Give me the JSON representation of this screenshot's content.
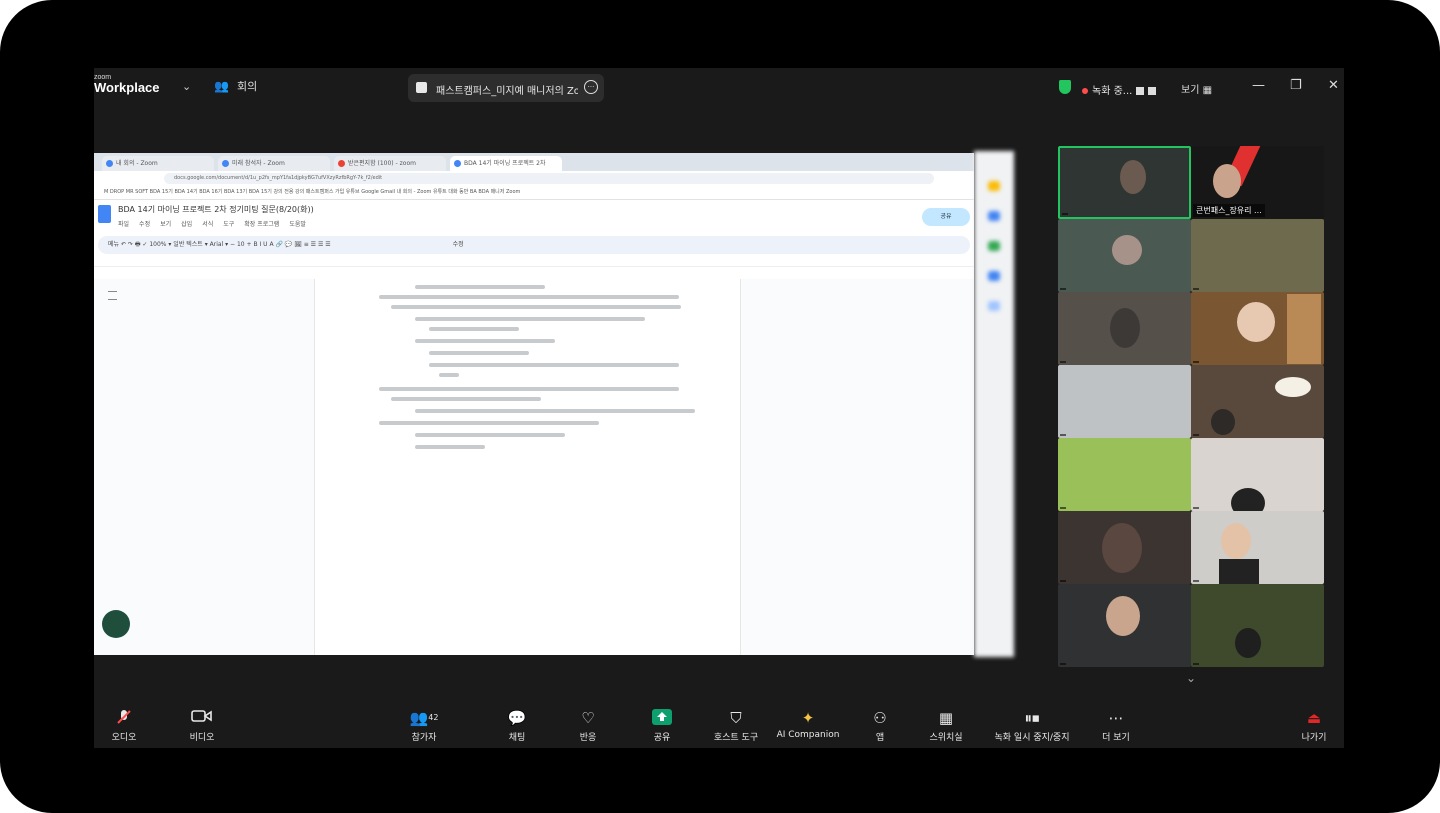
{
  "window": {
    "logo_top": "zoom",
    "logo_bottom": "Workplace",
    "meeting_label": "회의",
    "meeting_title": "패스트캠퍼스_미지예 매니저의 Zoom 회의",
    "recording_text": "녹화 중...",
    "view_label": "보기"
  },
  "shared_screen": {
    "browser_tabs": [
      {
        "label": "내 회의 - Zoom"
      },
      {
        "label": "미래 참석자 - Zoom"
      },
      {
        "label": "받은편지함 (100) - zoom"
      },
      {
        "label": "BDA 14기 마이닝 프로젝트 2차"
      }
    ],
    "address": "docs.google.com/document/d/1u_p2fs_mpY1fa1djpkyBG7ufVXzyRzfbRgY-7k_f2/edit",
    "bookmarks": "M DROP MR SOFT   BDA 15기   BDA 14기   BDA 16기   BDA 13기   BDA 15기   강의 전용   강의   패스트캠퍼스   가입   유튜브   Google   Gmail   내 회의 - Zoom   유튜트 대화 동반 BA   BDA 매니저   Zoom",
    "doc_title": "BDA 14기 마이닝 프로젝트 2차 정기미팅 질문(8/20(화))",
    "doc_menu": [
      "파일",
      "수정",
      "보기",
      "삽입",
      "서식",
      "도구",
      "확장 프로그램",
      "도움말"
    ],
    "share_button": "공유",
    "toolbar_text": "메뉴   ↶  ↷  🖶  ✓  100%  ▾   일반 텍스트  ▾   Arial  ▾   −  10  +   B  I  U  A   🔗  💬  🖼   ≡  ☰  ☰  ☰",
    "edit_mode": "수정"
  },
  "participants": [
    {
      "name": ""
    },
    {
      "name": "큰번패스_장유리 ..."
    },
    {
      "name": ""
    },
    {
      "name": ""
    },
    {
      "name": ""
    },
    {
      "name": ""
    },
    {
      "name": ""
    },
    {
      "name": ""
    },
    {
      "name": ""
    },
    {
      "name": ""
    },
    {
      "name": ""
    },
    {
      "name": ""
    },
    {
      "name": ""
    },
    {
      "name": ""
    }
  ],
  "toolbar": {
    "audio": "오디오",
    "video": "비디오",
    "participants": "참가자",
    "participant_count": "42",
    "chat": "채팅",
    "react": "반응",
    "share": "공유",
    "host_tools": "호스트 도구",
    "ai_companion": "AI Companion",
    "apps": "앱",
    "summary": "스위치실",
    "record": "녹화 일시 중지/중지",
    "more": "더 보기",
    "leave": "나가기"
  },
  "colors": {
    "frame": "#000000",
    "zoom_bg": "#1a1a1a",
    "share_green": "#0e9f6e",
    "leave_red": "#e02828",
    "security_green": "#22c55e",
    "ai_gold": "#f5c542"
  },
  "icons": [
    "chevron-down-icon",
    "people-icon",
    "shield-icon",
    "record-icon",
    "minimize-icon",
    "restore-icon",
    "close-icon",
    "mic-muted-icon",
    "video-icon",
    "participants-icon",
    "chat-icon",
    "heart-icon",
    "share-screen-icon",
    "host-shield-icon",
    "sparkle-icon",
    "apps-icon",
    "grid-icon",
    "pause-stop-icon",
    "ellipsis-icon",
    "leave-icon"
  ]
}
